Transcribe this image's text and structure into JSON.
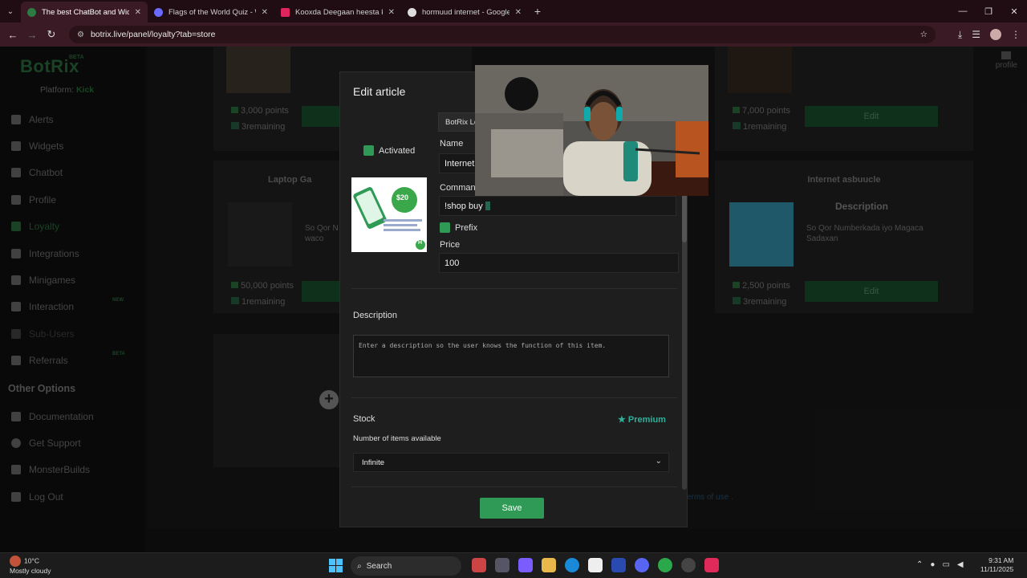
{
  "browser": {
    "tabs": [
      {
        "title": "The best ChatBot and Widgets f",
        "color": "#2e7a43",
        "active": true
      },
      {
        "title": "Flags of the World Quiz - World",
        "color": "#6a6aff",
        "active": false
      },
      {
        "title": "Kooxda Deegaan heesta kacdan",
        "color": "#e0245e",
        "active": false
      },
      {
        "title": "hormuud internet - Google Sear",
        "color": "#dddddd",
        "active": false
      }
    ],
    "url": "botrix.live/panel/loyalty?tab=store",
    "profile_label": "profile"
  },
  "sidebar": {
    "logo": "BotRix",
    "logo_badge": "BETA",
    "platform_label": "Platform:",
    "platform_value": "Kick",
    "items": [
      {
        "label": "Alerts",
        "icon": "alert-icon",
        "state": ""
      },
      {
        "label": "Widgets",
        "icon": "widgets-icon",
        "state": ""
      },
      {
        "label": "Chatbot",
        "icon": "chatbot-icon",
        "state": ""
      },
      {
        "label": "Profile",
        "icon": "profile-icon",
        "state": ""
      },
      {
        "label": "Loyalty",
        "icon": "loyalty-icon",
        "state": "active"
      },
      {
        "label": "Integrations",
        "icon": "integrations-icon",
        "state": ""
      },
      {
        "label": "Minigames",
        "icon": "minigames-icon",
        "state": ""
      },
      {
        "label": "Interaction",
        "icon": "music-icon",
        "state": "",
        "badge": "NEW"
      },
      {
        "label": "Sub-Users",
        "icon": "subusers-icon",
        "state": "dim"
      },
      {
        "label": "Referrals",
        "icon": "referrals-icon",
        "state": "",
        "badge": "BETA"
      }
    ],
    "other_title": "Other Options",
    "other_items": [
      {
        "label": "Documentation",
        "icon": "book-icon"
      },
      {
        "label": "Get Support",
        "icon": "support-icon"
      },
      {
        "label": "MonsterBuilds",
        "icon": "monitor-icon"
      },
      {
        "label": "Log Out",
        "icon": "logout-icon"
      }
    ]
  },
  "store": {
    "cards": [
      {
        "points": "3,000 points",
        "remaining": "3remaining"
      },
      {
        "points": "7,000 points",
        "remaining": "1remaining",
        "edit": "Edit"
      },
      {
        "title": "Laptop Ga",
        "desc": "So Qor N\nwaco",
        "points": "50,000 points",
        "remaining": "1remaining"
      },
      {
        "title": "Internet asbuucle",
        "desc_heading": "Description",
        "desc": "So Qor Numberkada iyo Magaca Sadaxan",
        "points": "2,500 points",
        "remaining": "3remaining",
        "edit": "Edit"
      }
    ],
    "terms": "erms of use ."
  },
  "modal": {
    "title": "Edit article",
    "activated_label": "Activated",
    "mini_dropdown": "BotRix Lo",
    "name_label": "Name",
    "name_value": "Internet",
    "command_label": "Command",
    "command_value": "!shop buy",
    "prefix_label": "Prefix",
    "price_label": "Price",
    "price_value": "100",
    "description_label": "Description",
    "description_placeholder": "Enter a description so the user knows the function of this item.",
    "stock_label": "Stock",
    "premium_label": "Premium",
    "items_available_label": "Number of items available",
    "stock_value": "Infinite",
    "save_label": "Save",
    "image_text": {
      "price": "$20",
      "brand": "H"
    }
  },
  "taskbar": {
    "temp": "10°C",
    "weather": "Mostly cloudy",
    "search": "Search",
    "time": "9:31 AM",
    "date": "11/11/2025"
  },
  "colors": {
    "accent": "#2f9a55",
    "premium": "#2fb09a",
    "browser_frame": "#3a1a24"
  }
}
